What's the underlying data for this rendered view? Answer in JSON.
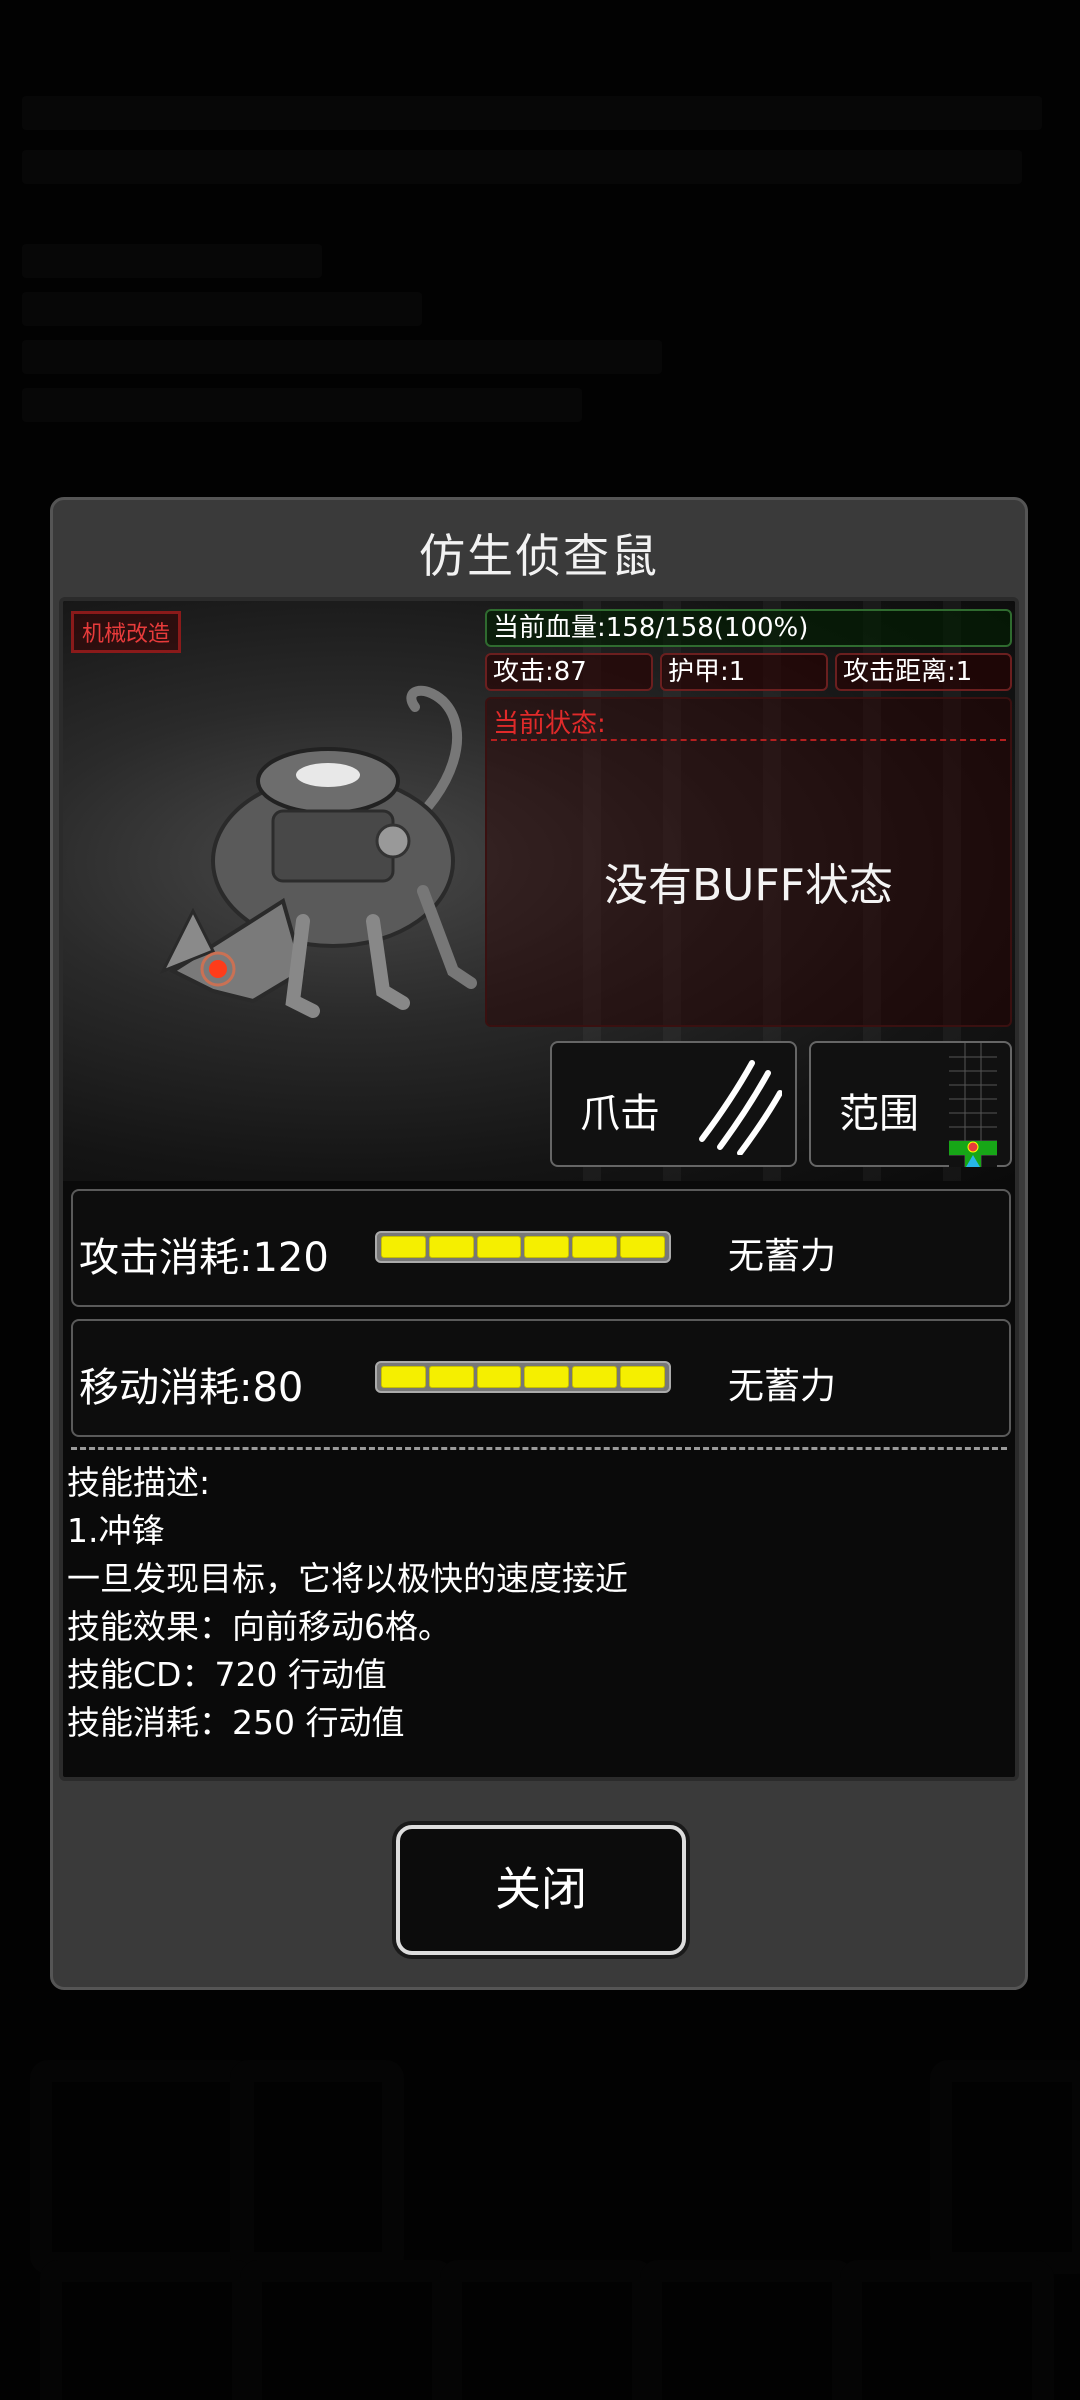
{
  "modal": {
    "title": "仿生侦查鼠",
    "tag": "机械改造",
    "stats": {
      "hp": "当前血量:158/158(100%)",
      "attack": "攻击:87",
      "armor": "护甲:1",
      "range": "攻击距离:1"
    },
    "status": {
      "label": "当前状态:",
      "empty_text": "没有BUFF状态"
    },
    "skills": [
      {
        "label": "爪击",
        "icon": "claw-slash-icon"
      },
      {
        "label": "范围",
        "icon": "range-grid-icon"
      }
    ],
    "costs": [
      {
        "label": "攻击消耗:120",
        "charge": "无蓄力",
        "fill": 1.0
      },
      {
        "label": "移动消耗:80",
        "charge": "无蓄力",
        "fill": 1.0
      }
    ],
    "description": {
      "heading": "技能描述:",
      "name": "1.冲锋",
      "text": "一旦发现目标，它将以极快的速度接近",
      "effect": "技能效果：向前移动6格。",
      "cd": "技能CD：720 行动值",
      "cost": "技能消耗：250 行动值"
    },
    "close_label": "关闭"
  },
  "colors": {
    "hp_border": "#2f6b2f",
    "stat_border": "#6b1f1f",
    "status_red": "#e02a2a",
    "bar_fill": "#f5ef00"
  }
}
